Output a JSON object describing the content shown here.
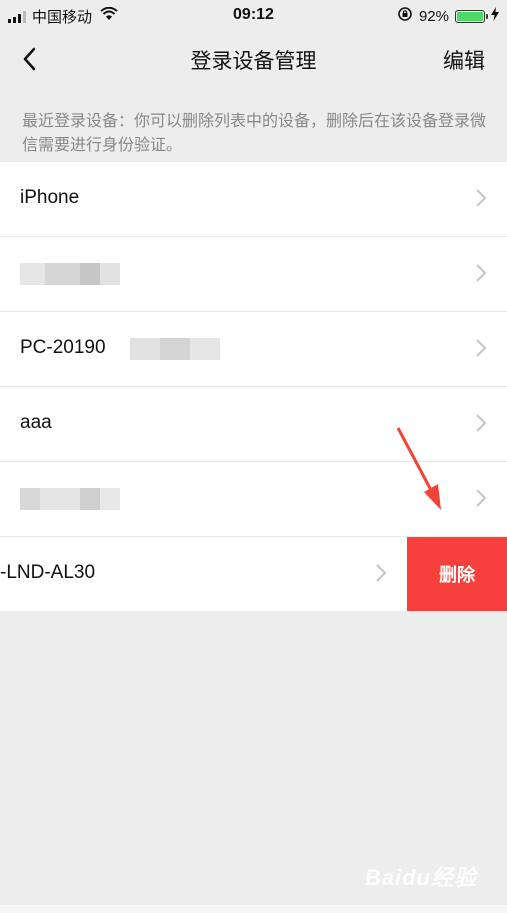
{
  "status_bar": {
    "carrier": "中国移动",
    "time": "09:12",
    "battery_percent": "92%",
    "battery_level": 0.92,
    "icons": [
      "signal-icon",
      "wifi-icon",
      "rotation-lock-icon",
      "battery-icon",
      "charging-icon"
    ]
  },
  "nav": {
    "back_icon": "chevron-left-icon",
    "title": "登录设备管理",
    "edit_label": "编辑"
  },
  "hint": "最近登录设备：你可以删除列表中的设备，删除后在该设备登录微信需要进行身份验证。",
  "devices": [
    {
      "label": "iPhone"
    },
    {
      "label": ""
    },
    {
      "label": "PC-20190"
    },
    {
      "label": "aaa"
    },
    {
      "label": ""
    },
    {
      "label": "-LND-AL30"
    }
  ],
  "delete_label": "删除",
  "colors": {
    "delete_bg": "#f7403b",
    "arrow": "#f0443a",
    "page_bg": "#ededed",
    "battery": "#4cd964"
  },
  "watermark": "Baidu经验"
}
